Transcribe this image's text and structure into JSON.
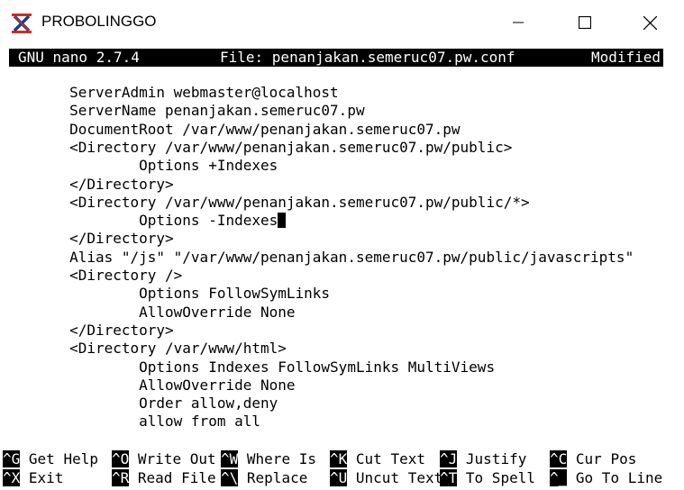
{
  "window": {
    "title": "PROBOLINGGO",
    "controls": {
      "minimize_icon": "minimize-icon",
      "maximize_icon": "maximize-icon",
      "close_icon": "close-icon"
    }
  },
  "nano": {
    "version": "GNU nano 2.7.4",
    "file": "File: penanjakan.semeruc07.pw.conf",
    "status": "Modified"
  },
  "editor": {
    "lines": [
      "        ServerAdmin webmaster@localhost",
      "        ServerName penanjakan.semeruc07.pw",
      "        DocumentRoot /var/www/penanjakan.semeruc07.pw",
      "        <Directory /var/www/penanjakan.semeruc07.pw/public>",
      "                Options +Indexes",
      "        </Directory>",
      "        <Directory /var/www/penanjakan.semeruc07.pw/public/*>",
      "                Options -Indexes",
      "        </Directory>",
      "        Alias \"/js\" \"/var/www/penanjakan.semeruc07.pw/public/javascripts\"",
      "        <Directory />",
      "                Options FollowSymLinks",
      "                AllowOverride None",
      "        </Directory>",
      "        <Directory /var/www/html>",
      "                Options Indexes FollowSymLinks MultiViews",
      "                AllowOverride None",
      "                Order allow,deny",
      "                allow from all"
    ]
  },
  "shortcuts": {
    "row1": [
      {
        "key": "^G",
        "label": "Get Help"
      },
      {
        "key": "^O",
        "label": "Write Out"
      },
      {
        "key": "^W",
        "label": "Where Is"
      },
      {
        "key": "^K",
        "label": "Cut Text"
      },
      {
        "key": "^J",
        "label": "Justify"
      },
      {
        "key": "^C",
        "label": "Cur Pos"
      }
    ],
    "row2": [
      {
        "key": "^X",
        "label": "Exit"
      },
      {
        "key": "^R",
        "label": "Read File"
      },
      {
        "key": "^\\",
        "label": "Replace"
      },
      {
        "key": "^U",
        "label": "Uncut Text"
      },
      {
        "key": "^T",
        "label": "To Spell"
      },
      {
        "key": "^_",
        "label": "Go To Line"
      }
    ]
  }
}
